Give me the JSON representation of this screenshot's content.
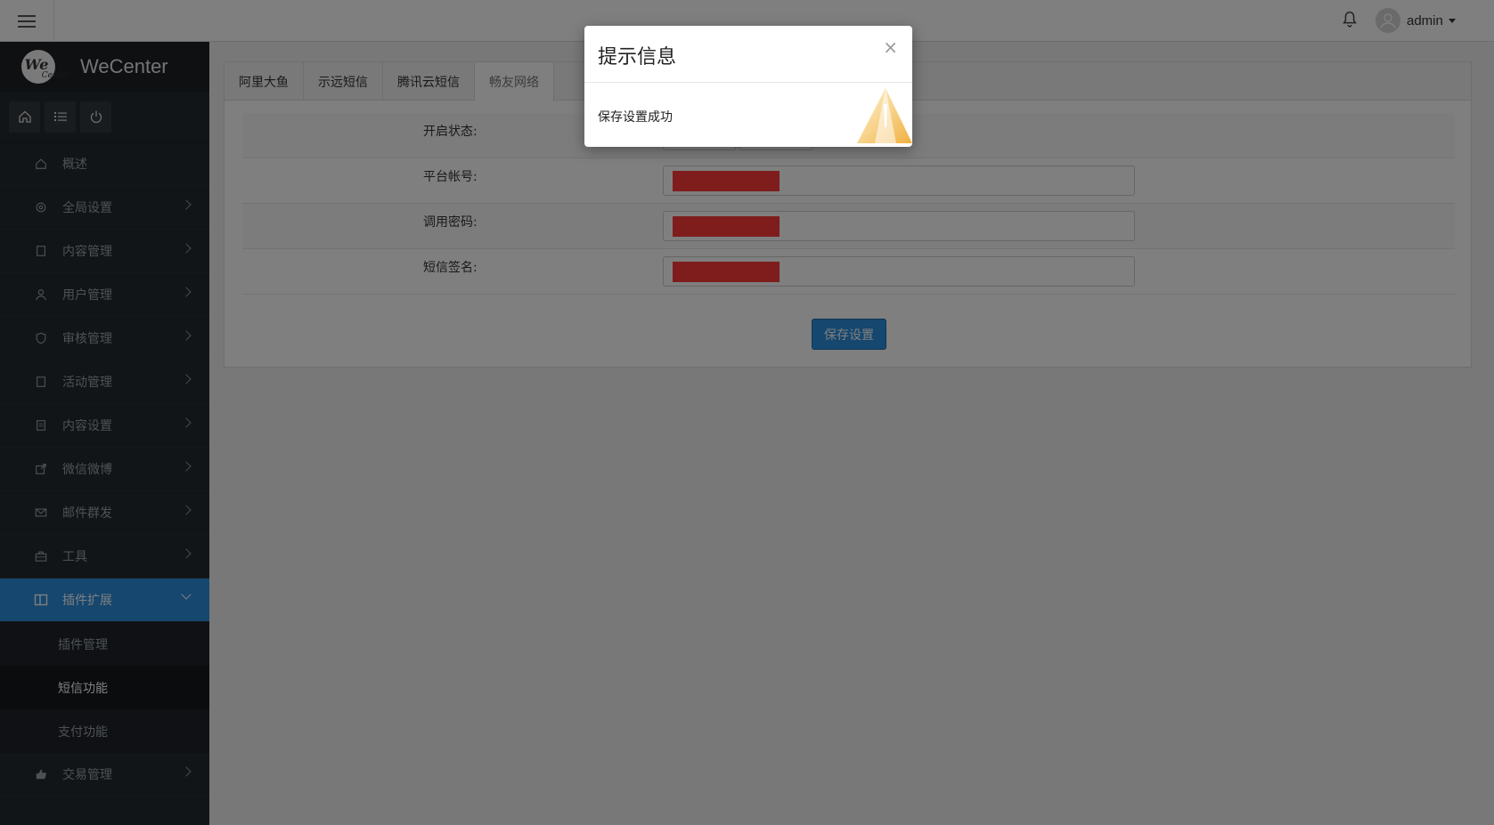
{
  "topbar": {
    "username": "admin",
    "icons": {
      "menu": "hamburger-icon",
      "bell": "bell-icon",
      "avatar": "user-icon"
    }
  },
  "sidebar": {
    "brand": {
      "logo_text": "We",
      "logo_sub": "Center",
      "name": "WeCenter"
    },
    "quick_icons": [
      "home-icon",
      "list-icon",
      "power-icon"
    ],
    "items": [
      {
        "label": "概述",
        "icon": "home-icon",
        "has_children": false
      },
      {
        "label": "全局设置",
        "icon": "gear-icon",
        "has_children": true
      },
      {
        "label": "内容管理",
        "icon": "document-icon",
        "has_children": true
      },
      {
        "label": "用户管理",
        "icon": "user-icon",
        "has_children": true
      },
      {
        "label": "审核管理",
        "icon": "shield-icon",
        "has_children": true
      },
      {
        "label": "活动管理",
        "icon": "document-icon",
        "has_children": true
      },
      {
        "label": "内容设置",
        "icon": "list-icon",
        "has_children": true
      },
      {
        "label": "微信微博",
        "icon": "share-icon",
        "has_children": true
      },
      {
        "label": "邮件群发",
        "icon": "mail-icon",
        "has_children": true
      },
      {
        "label": "工具",
        "icon": "toolbox-icon",
        "has_children": true
      },
      {
        "label": "插件扩展",
        "icon": "columns-icon",
        "has_children": true,
        "active": true
      },
      {
        "label": "交易管理",
        "icon": "thumbs-up-icon",
        "has_children": true
      }
    ],
    "submenu": [
      {
        "label": "插件管理"
      },
      {
        "label": "短信功能",
        "current": true
      },
      {
        "label": "支付功能"
      }
    ]
  },
  "main": {
    "tabs": [
      {
        "label": "阿里大鱼"
      },
      {
        "label": "示远短信"
      },
      {
        "label": "腾讯云短信"
      },
      {
        "label": "畅友网络",
        "active": true
      }
    ],
    "form": {
      "status_label": "开启状态:",
      "status_enabled": true,
      "account_label": "平台帐号:",
      "password_label": "调用密码:",
      "signature_label": "短信签名:",
      "save_label": "保存设置"
    }
  },
  "modal": {
    "title": "提示信息",
    "message": "保存设置成功",
    "close_symbol": "×",
    "icon": "warning-art-icon"
  },
  "colors": {
    "accent": "#2b8fde",
    "sidebar_bg": "#252a2f",
    "redaction": "#ff3a3a"
  }
}
